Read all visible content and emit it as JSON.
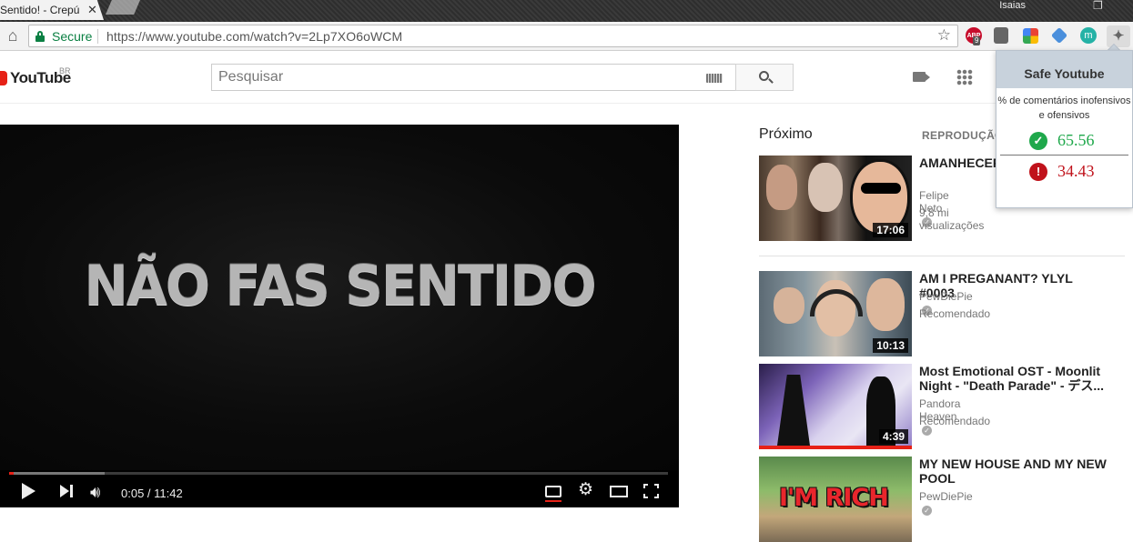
{
  "browser": {
    "tab_title": "Sentido! - Crepú",
    "tab_close": "✕",
    "profile_name": "Isaias",
    "secure_label": "Secure",
    "url": "https://www.youtube.com/watch?v=2Lp7XO6oWCM",
    "star_icon": "☆",
    "extensions": [
      {
        "name": "adblock-plus-icon",
        "label": "ABP",
        "badge": "9",
        "color": "#c70d2c"
      },
      {
        "name": "extension-2-icon",
        "label": "",
        "color": "#666666"
      },
      {
        "name": "chrome-extension-icon",
        "label": "",
        "color": "#4285f4"
      },
      {
        "name": "extension-4-icon",
        "label": "",
        "color": "#4a8fdc"
      },
      {
        "name": "extension-m-icon",
        "label": "m",
        "color": "#25b2a6"
      },
      {
        "name": "puzzle-icon",
        "label": "✦",
        "color": "#dcdcdc"
      }
    ]
  },
  "youtube": {
    "logo_text": "YouTube",
    "country_code": "BR",
    "search_placeholder": "Pesquisar",
    "brand_color": "#e62117"
  },
  "player": {
    "video_title_art": "NÃO FAS SENTIDO",
    "time_display": "0:05 / 11:42",
    "progress_played": 0.007,
    "progress_loaded": 0.145
  },
  "sidebar": {
    "up_next_label": "Próximo",
    "autoplay_label": "REPRODUÇÃO",
    "videos": [
      {
        "title": "AMANHECER CREPÚSCULO",
        "channel": "Felipe Neto",
        "meta": "9,8 mi visualizações",
        "duration": "17:06",
        "watched": false
      },
      {
        "title": "AM I PREGANANT? YLYL #0003",
        "channel": "PewDiePie",
        "meta": "Recomendado",
        "duration": "10:13",
        "watched": false
      },
      {
        "title": "Most Emotional OST - Moonlit Night - \"Death Parade\" - デス...",
        "channel": "Pandora Heaven",
        "meta": "Recomendado",
        "duration": "4:39",
        "watched": true
      },
      {
        "title": "MY NEW HOUSE AND MY NEW POOL",
        "channel": "PewDiePie",
        "meta": "Recomendado",
        "duration": "",
        "thumb_text": "I'M RICH",
        "watched": false
      }
    ]
  },
  "safe_youtube": {
    "title": "Safe Youtube",
    "description": "% de comentários inofensivos e ofensivos",
    "harmless_percent": "65.56",
    "offensive_percent": "34.43",
    "positive_color": "#1fa84b",
    "negative_color": "#c0121b"
  }
}
